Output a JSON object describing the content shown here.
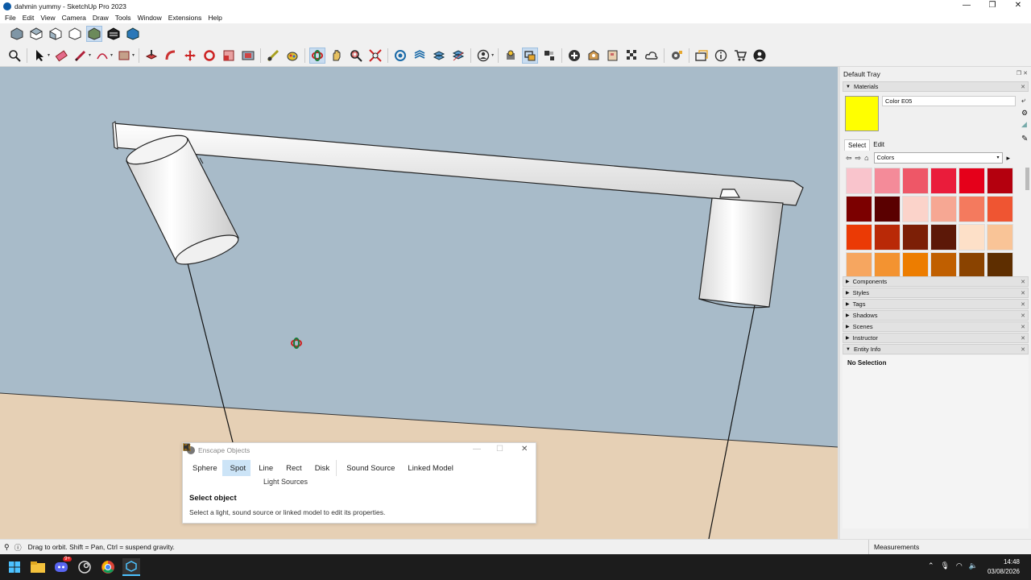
{
  "window": {
    "title": "dahmin yummy - SketchUp Pro 2023",
    "controls": [
      "—",
      "❐",
      "✕"
    ]
  },
  "menu": [
    "File",
    "Edit",
    "View",
    "Camera",
    "Draw",
    "Tools",
    "Window",
    "Extensions",
    "Help"
  ],
  "toolbar_views": [
    {
      "name": "iso-view-icon"
    },
    {
      "name": "top-view-icon"
    },
    {
      "name": "front-view-icon"
    },
    {
      "name": "right-view-icon"
    },
    {
      "name": "back-view-icon"
    },
    {
      "name": "left-view-icon"
    },
    {
      "name": "bottom-view-icon"
    }
  ],
  "toolbar_main": [
    "zoom-icon",
    "select-icon",
    "eraser-icon",
    "pencil-icon",
    "arc-icon",
    "rectangle-icon",
    "push-pull-icon",
    "follow-me-icon",
    "move-icon",
    "rotate-icon",
    "scale-icon",
    "offset-icon",
    "tape-measure-icon",
    "paint-bucket-icon",
    "orbit-icon",
    "pan-icon",
    "zoom-window-icon",
    "zoom-extents-icon",
    "section-plane-icon",
    "section-display-icon",
    "section-fill-icon",
    "layers-icon",
    "user-icon",
    "warehouse-icon",
    "extension-icon",
    "materials-icon",
    "styles-icon",
    "add-location-icon",
    "geo-icon",
    "grid-icon",
    "cloud-icon",
    "settings-icon",
    "folder-icon",
    "info-icon",
    "cart-icon",
    "account-icon"
  ],
  "tray": {
    "title": "Default Tray",
    "materials": {
      "header": "Materials",
      "name": "Color E05",
      "swatch": "#ffff00",
      "tabs": [
        "Select",
        "Edit"
      ],
      "library": "Colors",
      "colors": [
        "#f9c4cc",
        "#f48b99",
        "#ee5767",
        "#ea1c3b",
        "#e5001a",
        "#b4000e",
        "#7c0000",
        "#5a0000",
        "#fbd3ca",
        "#f6a793",
        "#f47a5e",
        "#ef5532",
        "#eb3a05",
        "#b92907",
        "#7c1f06",
        "#5c1808",
        "#fde0c8",
        "#f9c497",
        "#f6a660",
        "#f39331",
        "#ed7d00",
        "#c05f00",
        "#8a4300",
        "#5e2e00"
      ]
    },
    "panels": [
      "Components",
      "Styles",
      "Tags",
      "Shadows",
      "Scenes",
      "Instructor"
    ],
    "entity_info": {
      "header": "Entity Info",
      "status": "No Selection"
    }
  },
  "enscape": {
    "title": "Enscape Objects",
    "tools": [
      {
        "label": "Sphere",
        "icon": "sphere-icon",
        "selected": false
      },
      {
        "label": "Spot",
        "icon": "spot-icon",
        "selected": true
      },
      {
        "label": "Line",
        "icon": "line-icon",
        "selected": false
      },
      {
        "label": "Rect",
        "icon": "rect-icon",
        "selected": false
      },
      {
        "label": "Disk",
        "icon": "disk-icon",
        "selected": false
      }
    ],
    "extra_tools": [
      {
        "label": "Sound Source",
        "icon": "sound-source-icon"
      },
      {
        "label": "Linked Model",
        "icon": "linked-model-icon"
      }
    ],
    "group_label": "Light Sources",
    "select_title": "Select object",
    "select_desc": "Select a light, sound source or linked model to edit its properties."
  },
  "status": {
    "hint": "Drag to orbit. Shift = Pan, Ctrl = suspend gravity.",
    "measurements": "Measurements"
  },
  "taskbar": {
    "time": "14:48",
    "date": "03/08/2026",
    "badge": "9+"
  }
}
